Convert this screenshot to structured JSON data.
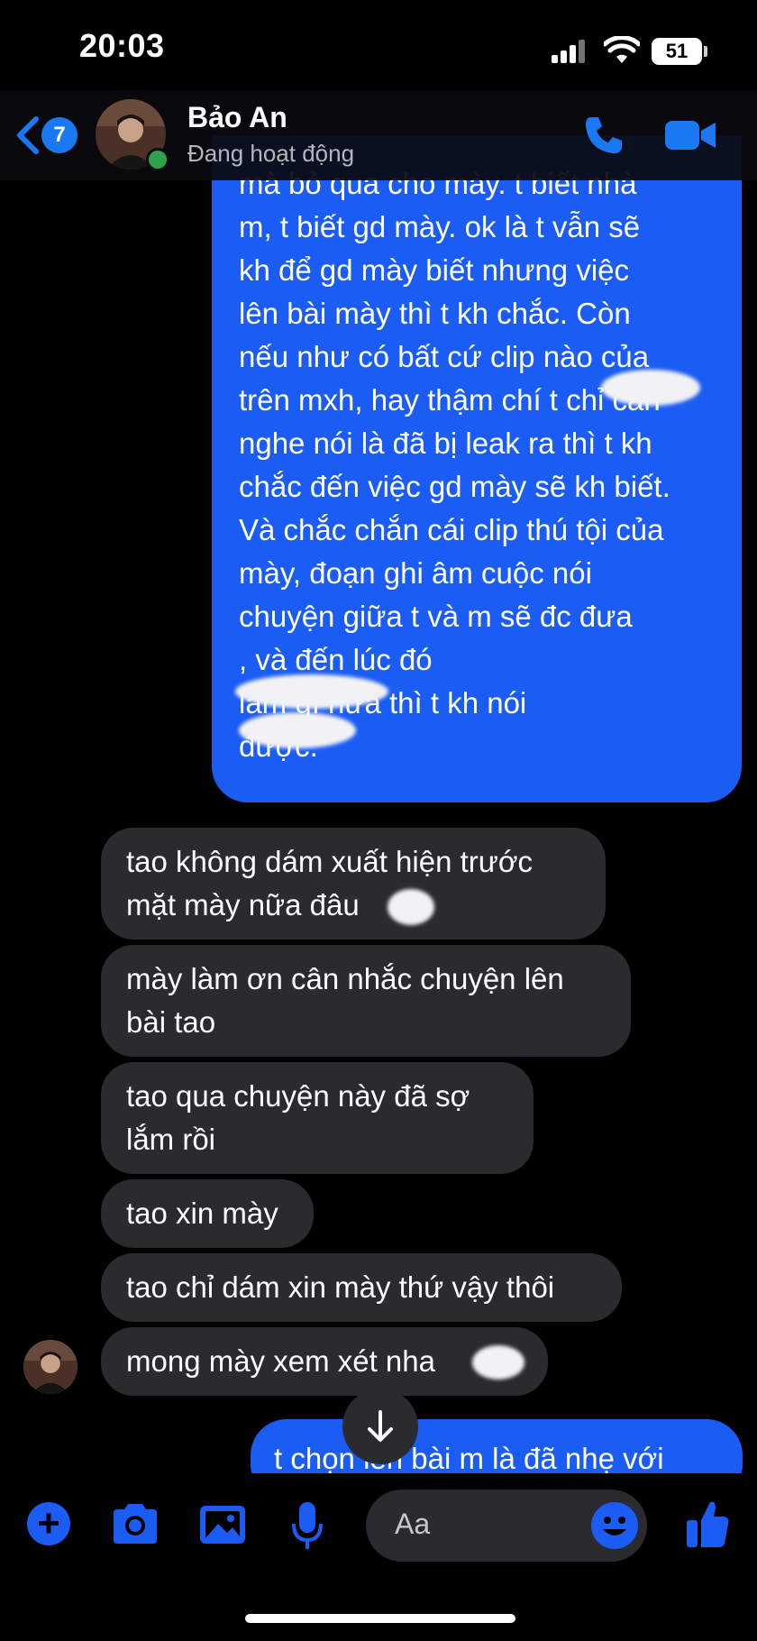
{
  "status_bar": {
    "time": "20:03",
    "battery": "51"
  },
  "header": {
    "back_badge": "7",
    "contact_name": "Bảo An",
    "contact_status": "Đang hoạt động"
  },
  "messages": {
    "outgoing_long": "mà bỏ qua cho mày. t biết nhà\nm, t biết gd mày. ok là t vẫn sẽ\nkh để gd mày biết nhưng việc\nlên bài mày thì t kh chắc. Còn\nnếu như có bất cứ clip nào của\ntrên mxh, hay thậm chí t chỉ cần\nnghe nói là đã bị leak ra thì t kh\nchắc đến việc gd mày sẽ kh biết.\nVà chắc chắn cái clip thú tội của\nmày, đoạn ghi âm cuộc nói\nchuyện giữa t và m sẽ đc đưa\n, và đến lúc đó\nlàm gì nữa thì t kh nói\nđược.",
    "incoming": [
      "tao không dám xuất hiện trước\nmặt mày nữa đâu",
      "mày làm ơn cân nhắc chuyện lên\nbài tao",
      "tao qua chuyện này đã sợ\nlắm rồi",
      "tao xin mày",
      "tao chỉ dám xin mày thứ vậy thôi",
      "mong mày xem xét nha"
    ],
    "outgoing_last": "t chọn lên bài m là đã nhẹ với"
  },
  "composer": {
    "placeholder": "Aa"
  },
  "colors": {
    "outgoing": "#1b5cf5",
    "incoming": "#2b2b2f",
    "accent": "#1a78f2"
  }
}
